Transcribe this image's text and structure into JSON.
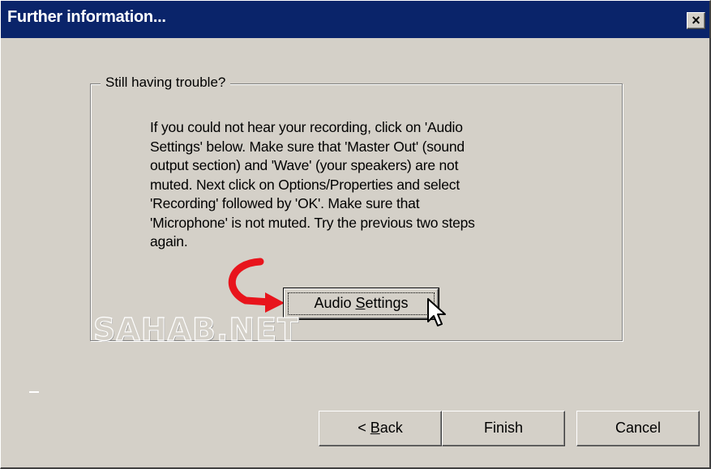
{
  "window": {
    "title": "Further information...",
    "close_symbol": "×"
  },
  "group": {
    "legend": "Still having trouble?",
    "body": "If you could not hear your recording, click on 'Audio\nSettings' below.  Make sure that 'Master Out' (sound\noutput section) and 'Wave' (your speakers) are not\nmuted.  Next click on Options/Properties and select\n'Recording' followed by 'OK'.  Make sure that\n'Microphone' is not muted.  Try the previous two steps\nagain.",
    "audio_settings_prefix": "Audio ",
    "audio_settings_mnemonic": "S",
    "audio_settings_suffix": "ettings"
  },
  "watermark": "SAHAB.NET",
  "footer": {
    "back_prefix": "< ",
    "back_mnemonic": "B",
    "back_suffix": "ack",
    "finish": "Finish",
    "cancel": "Cancel"
  },
  "colors": {
    "face": "#d4d0c8",
    "titlebar": "#0a246a",
    "arrow": "#e8141c"
  },
  "icons": [
    "close-icon",
    "red-curved-arrow-icon",
    "mouse-pointer-icon"
  ]
}
